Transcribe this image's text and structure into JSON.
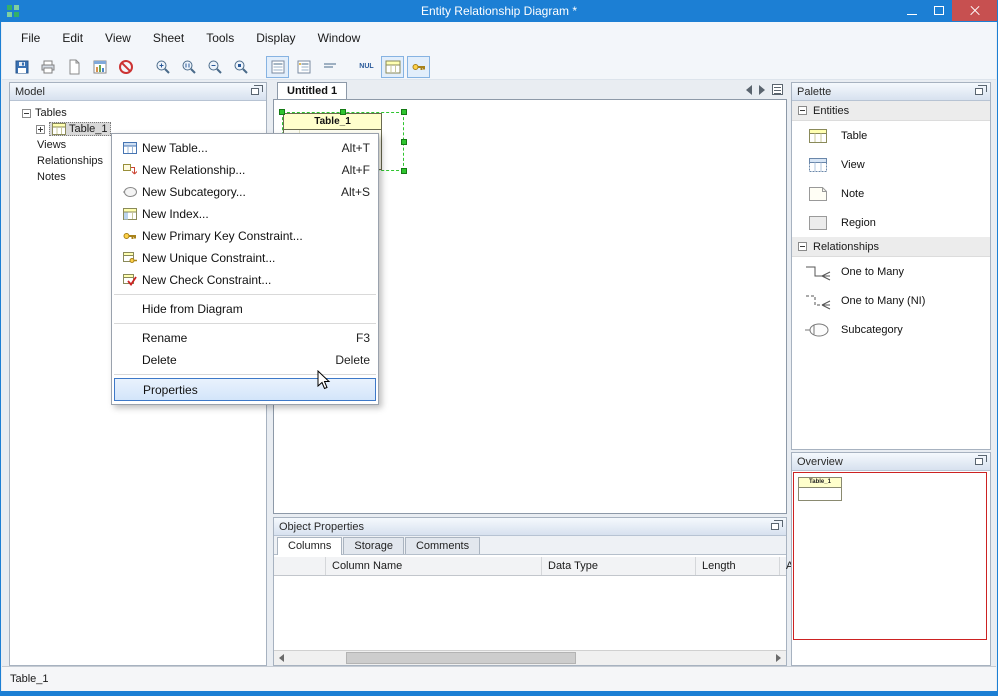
{
  "window": {
    "title": "Entity Relationship Diagram *",
    "icons": [
      "app-icon",
      "minimize-icon",
      "maximize-icon",
      "close-icon"
    ]
  },
  "menu": {
    "items": [
      "File",
      "Edit",
      "View",
      "Sheet",
      "Tools",
      "Display",
      "Window"
    ]
  },
  "toolbar": {
    "icons": [
      "save-icon",
      "print-icon",
      "new-page-icon",
      "report-icon",
      "stop-edit-icon",
      "zoom-in-icon",
      "zoom-actual-icon",
      "zoom-out-icon",
      "zoom-fit-icon",
      "view-columns-icon",
      "view-keys-columns-icon",
      "view-names-icon",
      "show-nullable-icon",
      "show-datatypes-icon",
      "show-keys-icon"
    ],
    "nul_label": "NUL"
  },
  "model_panel": {
    "title": "Model",
    "tree": [
      {
        "label": "Tables"
      },
      {
        "label": "Table_1"
      },
      {
        "label": "Views"
      },
      {
        "label": "Relationships"
      },
      {
        "label": "Notes"
      }
    ]
  },
  "canvas": {
    "tab": "Untitled 1",
    "entity_name": "Table_1"
  },
  "context_menu": {
    "items": [
      {
        "label": "New Table...",
        "shortcut": "Alt+T"
      },
      {
        "label": "New Relationship...",
        "shortcut": "Alt+F"
      },
      {
        "label": "New Subcategory...",
        "shortcut": "Alt+S"
      },
      {
        "label": "New Index...",
        "shortcut": ""
      },
      {
        "label": "New Primary Key Constraint...",
        "shortcut": ""
      },
      {
        "label": "New Unique Constraint...",
        "shortcut": ""
      },
      {
        "label": "New Check Constraint...",
        "shortcut": ""
      },
      {
        "separator": true
      },
      {
        "label": "Hide from Diagram",
        "shortcut": ""
      },
      {
        "separator": true
      },
      {
        "label": "Rename",
        "shortcut": "F3"
      },
      {
        "label": "Delete",
        "shortcut": "Delete"
      },
      {
        "separator": true
      },
      {
        "label": "Properties",
        "shortcut": "",
        "highlighted": true
      }
    ]
  },
  "palette": {
    "title": "Palette",
    "sections": [
      {
        "title": "Entities",
        "items": [
          {
            "label": "Table"
          },
          {
            "label": "View"
          },
          {
            "label": "Note"
          },
          {
            "label": "Region"
          }
        ]
      },
      {
        "title": "Relationships",
        "items": [
          {
            "label": "One to Many"
          },
          {
            "label": "One to Many (NI)"
          },
          {
            "label": "Subcategory"
          }
        ]
      }
    ]
  },
  "overview": {
    "title": "Overview",
    "mini_entity": "Table_1"
  },
  "object_properties": {
    "title": "Object Properties",
    "tabs": [
      "Columns",
      "Storage",
      "Comments"
    ],
    "columns": [
      "",
      "Column Name",
      "Data Type",
      "Length",
      "A"
    ]
  },
  "status_bar": {
    "text": "Table_1"
  },
  "colors": {
    "titlebar": "#1c7fd4",
    "close_button": "#c75050",
    "selection_handle": "#2fc52f",
    "entity_fill": "#ffffcc",
    "highlight_border": "#3d78c8",
    "overview_border": "#cc2222"
  }
}
